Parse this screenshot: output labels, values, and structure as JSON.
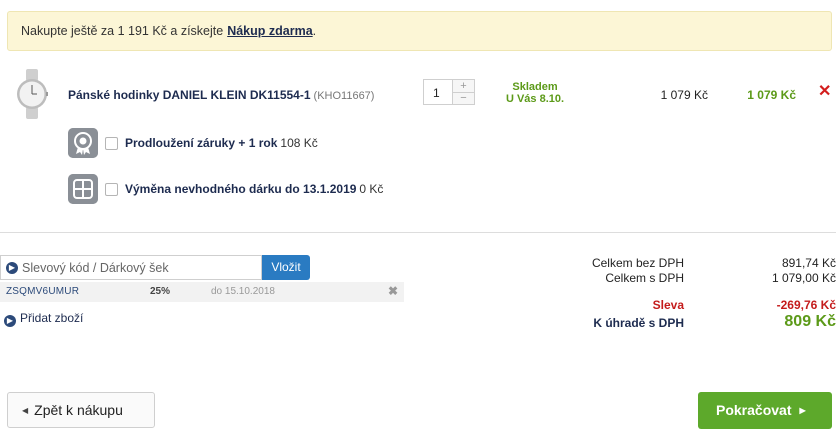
{
  "banner": {
    "text": "Nakupte ještě za 1 191 Kč a získejte",
    "link": "Nákup zdarma",
    "end": "."
  },
  "product": {
    "name": "Pánské hodinky DANIEL KLEIN DK11554-1",
    "code": "(KHO11667)",
    "quantity": "1",
    "plus": "+",
    "minus": "−",
    "stock_line1": "Skladem",
    "stock_line2": "U Vás 8.10.",
    "unit_price": "1 079 Kč",
    "total_price": "1 079 Kč",
    "remove": "✕"
  },
  "addons": [
    {
      "label": "Prodloužení záruky + 1 rok",
      "price": "108 Kč",
      "icon": "warranty-icon"
    },
    {
      "label": "Výměna nevhodného dárku do 13.1.2019",
      "price": "0 Kč",
      "icon": "gift-exchange-icon"
    }
  ],
  "coupon": {
    "placeholder": "Slevový kód / Dárkový šek",
    "button": "Vložit",
    "applied": {
      "code": "ZSQMV6UMUR",
      "percent": "25%",
      "valid_until": "do 15.10.2018",
      "remove": "✖"
    }
  },
  "add_goods": "Přidat zboží",
  "summary": {
    "net_label": "Celkem bez DPH",
    "net_value": "891,74 Kč",
    "gross_label": "Celkem s DPH",
    "gross_value": "1 079,00 Kč",
    "discount_label": "Sleva",
    "discount_value": "-269,76 Kč",
    "total_label": "K úhradě s DPH",
    "total_value": "809 Kč"
  },
  "buttons": {
    "back": "Zpět k nákupu",
    "next": "Pokračovat"
  },
  "colors": {
    "accent_green": "#5da92b",
    "blue_button": "#2a7bc2",
    "red": "#d31d1d",
    "banner_bg": "#fcf6d6"
  }
}
